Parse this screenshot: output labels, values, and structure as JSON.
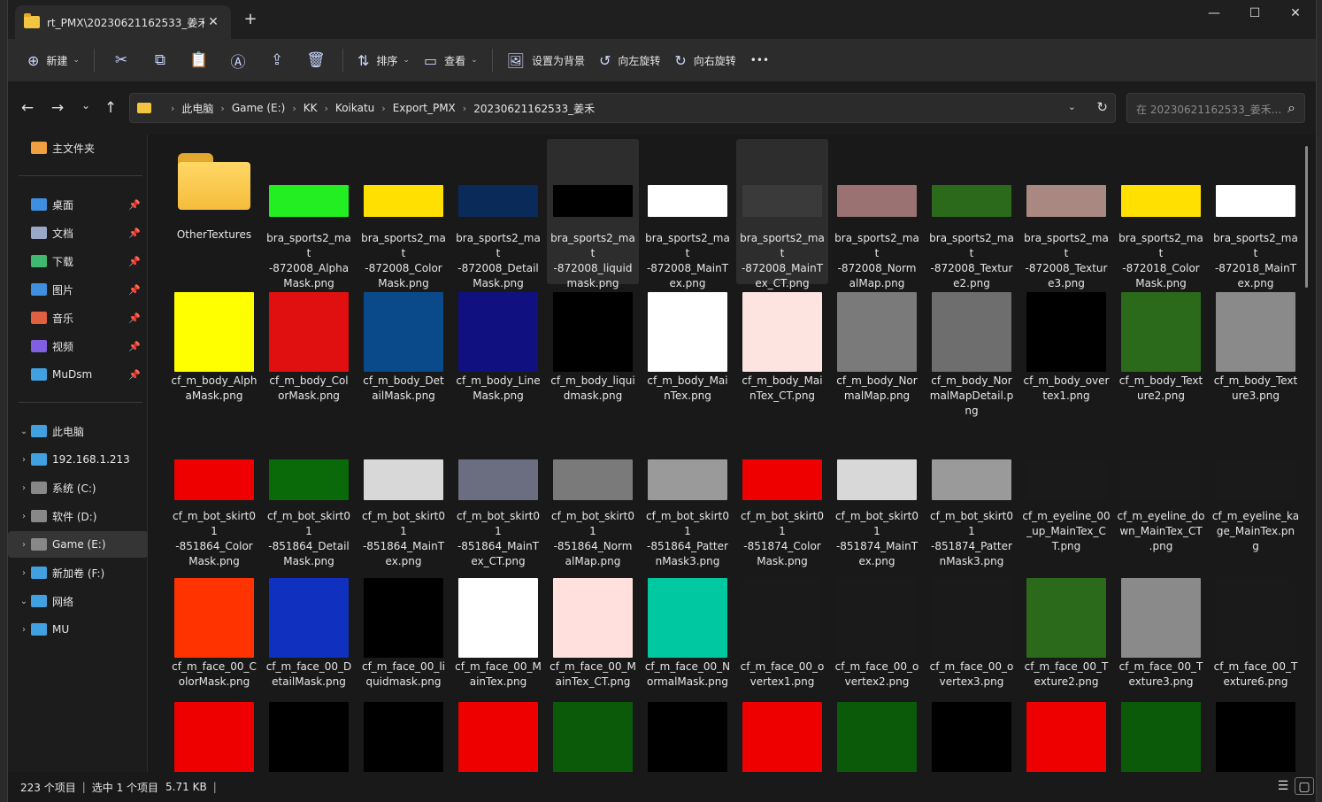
{
  "window": {
    "tab_title": "rt_PMX\\20230621162533_姜禾",
    "tab_close": "✕",
    "new_tab": "+",
    "minimize": "—",
    "maximize": "☐",
    "close": "✕"
  },
  "toolbar": {
    "new": "新建",
    "sort": "排序",
    "view": "查看",
    "set_bg": "设置为背景",
    "rotate_left": "向左旋转",
    "rotate_right": "向右旋转",
    "more": "•••"
  },
  "address": {
    "crumbs": [
      "此电脑",
      "Game (E:)",
      "KK",
      "Koikatu",
      "Export_PMX",
      "20230621162533_姜禾"
    ],
    "search_placeholder": "在 20230621162533_姜禾..."
  },
  "sidebar": {
    "items": [
      "主文件夹",
      "桌面",
      "文档",
      "下载",
      "图片",
      "音乐",
      "视频",
      "MuDsm",
      "此电脑",
      "192.168.1.213",
      "系统 (C:)",
      "软件 (D:)",
      "Game (E:)",
      "新加卷 (F:)",
      "网络",
      "MU"
    ]
  },
  "files": [
    {
      "label": "OtherTextures",
      "type": "folder"
    },
    {
      "label": "bra_sports2_ma\nt\n-872008_Alpha\nMask.png",
      "color": "#22ee22"
    },
    {
      "label": "bra_sports2_ma\nt\n-872008_Color\nMask.png",
      "color": "#ffe000"
    },
    {
      "label": "bra_sports2_ma\nt\n-872008_Detail\nMask.png",
      "color": "#0a2a5a"
    },
    {
      "label": "bra_sports2_ma\nt\n-872008_liquid\nmask.png",
      "color": "#000000"
    },
    {
      "label": "bra_sports2_ma\nt\n-872008_MainT\nex.png",
      "color": "#ffffff"
    },
    {
      "label": "bra_sports2_ma\nt\n-872008_MainT\nex_CT.png",
      "color": "#3a3a3a"
    },
    {
      "label": "bra_sports2_ma\nt\n-872008_Norm\nalMap.png",
      "color": "#9b7272"
    },
    {
      "label": "bra_sports2_ma\nt\n-872008_Textur\ne2.png",
      "color": "#2a6a1a"
    },
    {
      "label": "bra_sports2_ma\nt\n-872008_Textur\ne3.png",
      "color": "#a88880"
    },
    {
      "label": "bra_sports2_ma\nt\n-872018_Color\nMask.png",
      "color": "#ffe000"
    },
    {
      "label": "bra_sports2_ma\nt\n-872018_MainT\nex.png",
      "color": "#ffffff"
    },
    {
      "label": "cf_m_body_Alph\naMask.png",
      "color": "#ffff00"
    },
    {
      "label": "cf_m_body_Col\norMask.png",
      "color": "#e01010"
    },
    {
      "label": "cf_m_body_Det\nailMask.png",
      "color": "#0a4a8a"
    },
    {
      "label": "cf_m_body_Line\nMask.png",
      "color": "#101080"
    },
    {
      "label": "cf_m_body_liqui\ndmask.png",
      "color": "#000000"
    },
    {
      "label": "cf_m_body_Mai\nnTex.png",
      "color": "#ffffff"
    },
    {
      "label": "cf_m_body_Mai\nnTex_CT.png",
      "color": "#fde4e0"
    },
    {
      "label": "cf_m_body_Nor\nmalMap.png",
      "color": "#7a7a7a"
    },
    {
      "label": "cf_m_body_Nor\nmalMapDetail.p\nng",
      "color": "#6e6e6e"
    },
    {
      "label": "cf_m_body_over\ntex1.png",
      "color": "#000000"
    },
    {
      "label": "cf_m_body_Text\nure2.png",
      "color": "#2a6a1a"
    },
    {
      "label": "cf_m_body_Text\nure3.png",
      "color": "#8a8a8a"
    },
    {
      "label": "cf_m_bot_skirt0\n1\n-851864_Color\nMask.png",
      "color": "#ee0000"
    },
    {
      "label": "cf_m_bot_skirt0\n1\n-851864_Detail\nMask.png",
      "color": "#0a6a0a"
    },
    {
      "label": "cf_m_bot_skirt0\n1\n-851864_MainT\nex.png",
      "color": "#d8d8d8"
    },
    {
      "label": "cf_m_bot_skirt0\n1\n-851864_MainT\nex_CT.png",
      "color": "#6a6e80"
    },
    {
      "label": "cf_m_bot_skirt0\n1\n-851864_Norm\nalMap.png",
      "color": "#7a7a7a"
    },
    {
      "label": "cf_m_bot_skirt0\n1\n-851864_Patter\nnMask3.png",
      "color": "#9a9a9a"
    },
    {
      "label": "cf_m_bot_skirt0\n1\n-851874_Color\nMask.png",
      "color": "#ee0000"
    },
    {
      "label": "cf_m_bot_skirt0\n1\n-851874_MainT\nex.png",
      "color": "#d8d8d8"
    },
    {
      "label": "cf_m_bot_skirt0\n1\n-851874_Patter\nnMask3.png",
      "color": "#9a9a9a"
    },
    {
      "label": "cf_m_eyeline_00\n_up_MainTex_C\nT.png",
      "color": "#1a1a1a"
    },
    {
      "label": "cf_m_eyeline_do\nwn_MainTex_CT\n.png",
      "color": "#1a1a1a"
    },
    {
      "label": "cf_m_eyeline_ka\nge_MainTex.pn\ng",
      "color": "#1a1a1a"
    },
    {
      "label": "cf_m_face_00_C\nolorMask.png",
      "color": "#ff3300"
    },
    {
      "label": "cf_m_face_00_D\netailMask.png",
      "color": "#1030c0"
    },
    {
      "label": "cf_m_face_00_li\nquidmask.png",
      "color": "#000000"
    },
    {
      "label": "cf_m_face_00_M\nainTex.png",
      "color": "#ffffff"
    },
    {
      "label": "cf_m_face_00_M\nainTex_CT.png",
      "color": "#ffe0dc"
    },
    {
      "label": "cf_m_face_00_N\normalMask.png",
      "color": "#00c8a0"
    },
    {
      "label": "cf_m_face_00_o\nvertex1.png",
      "color": "#1a1a1a"
    },
    {
      "label": "cf_m_face_00_o\nvertex2.png",
      "color": "#1a1a1a"
    },
    {
      "label": "cf_m_face_00_o\nvertex3.png",
      "color": "#1a1a1a"
    },
    {
      "label": "cf_m_face_00_T\nexture2.png",
      "color": "#2a6a1a"
    },
    {
      "label": "cf_m_face_00_T\nexture3.png",
      "color": "#8a8a8a"
    },
    {
      "label": "cf_m_face_00_T\nexture6.png",
      "color": "#1a1a1a"
    },
    {
      "label": "",
      "color": "#ee0000"
    },
    {
      "label": "",
      "color": "#000000"
    },
    {
      "label": "",
      "color": "#000000"
    },
    {
      "label": "",
      "color": "#ee0000"
    },
    {
      "label": "",
      "color": "#0a5a0a"
    },
    {
      "label": "",
      "color": "#000000"
    },
    {
      "label": "",
      "color": "#ee0000"
    },
    {
      "label": "",
      "color": "#0a5a0a"
    },
    {
      "label": "",
      "color": "#000000"
    },
    {
      "label": "",
      "color": "#ee0000"
    },
    {
      "label": "",
      "color": "#0a5a0a"
    },
    {
      "label": "",
      "color": "#000000"
    }
  ],
  "status": {
    "count": "223 个项目",
    "selected": "选中 1 个项目",
    "size": "5.71 KB"
  }
}
